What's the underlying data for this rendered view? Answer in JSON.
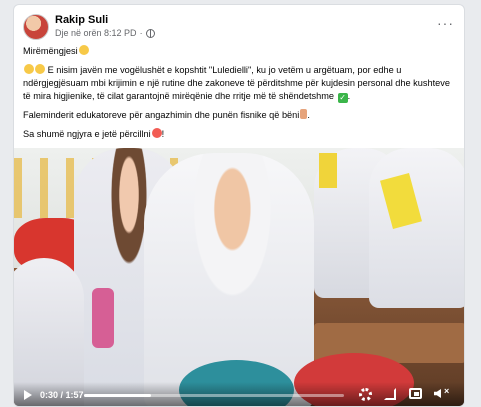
{
  "post": {
    "author": "Rakip Suli",
    "timestamp": "Dje në orën 8:12 PD",
    "separator": "·",
    "more_label": "···",
    "greeting": "Mirëmëngjesi",
    "paragraph1": "E nisim javën me vogëlushët e kopshtit \"Luledielli\", ku jo vetëm u argëtuam, por edhe u ndërgjegjësuam mbi krijimin e një rutine dhe zakoneve të përditshme për kujdesin personal dhe kushteve të mira higjienike, të cilat garantojnë mirëqënie dhe rritje më të shëndetshme",
    "paragraph2": "Faleminderit edukatoreve për angazhimin dhe punën fisnike që bëni",
    "paragraph3": "Sa shumë ngjyra e jetë përcillni",
    "check_glyph": "✓"
  },
  "video": {
    "current_time": "0:30",
    "duration": "1:57",
    "time_label": "0:30 / 1:57",
    "progress_fraction": 0.256,
    "mute_glyph": "×"
  },
  "icons": [
    "globe-icon",
    "more-icon",
    "play-icon",
    "settings-icon",
    "fullscreen-icon",
    "pip-icon",
    "volume-muted-icon"
  ]
}
